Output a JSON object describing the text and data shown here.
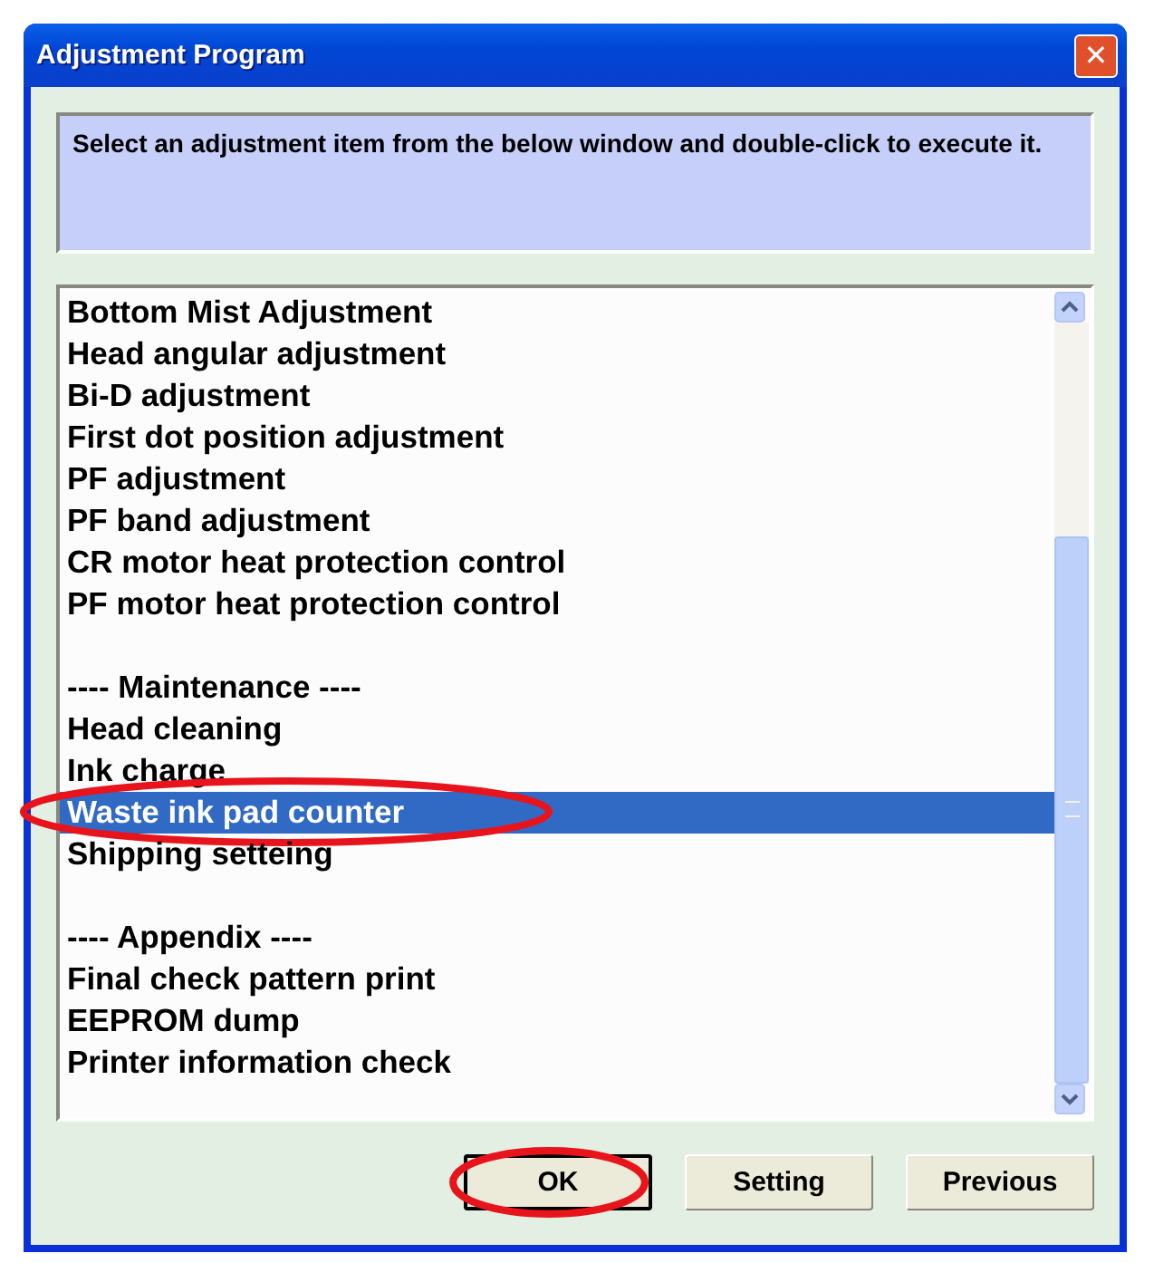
{
  "window": {
    "title": "Adjustment Program",
    "close": "✕"
  },
  "message": "Select an adjustment item from the below window and double-click to execute it.",
  "list": [
    {
      "kind": "item",
      "label": "Bottom Mist Adjustment",
      "selected": false,
      "circled": false
    },
    {
      "kind": "item",
      "label": "Head angular adjustment",
      "selected": false,
      "circled": false
    },
    {
      "kind": "item",
      "label": "Bi-D adjustment",
      "selected": false,
      "circled": false
    },
    {
      "kind": "item",
      "label": "First dot position adjustment",
      "selected": false,
      "circled": false
    },
    {
      "kind": "item",
      "label": "PF adjustment",
      "selected": false,
      "circled": false
    },
    {
      "kind": "item",
      "label": "PF band adjustment",
      "selected": false,
      "circled": false
    },
    {
      "kind": "item",
      "label": "CR motor heat protection control",
      "selected": false,
      "circled": false
    },
    {
      "kind": "item",
      "label": "PF motor heat protection control",
      "selected": false,
      "circled": false
    },
    {
      "kind": "spacer"
    },
    {
      "kind": "item",
      "label": "---- Maintenance ----",
      "selected": false,
      "circled": false
    },
    {
      "kind": "item",
      "label": "Head cleaning",
      "selected": false,
      "circled": false
    },
    {
      "kind": "item",
      "label": "Ink charge",
      "selected": false,
      "circled": false
    },
    {
      "kind": "item",
      "label": "Waste ink pad counter",
      "selected": true,
      "circled": true
    },
    {
      "kind": "item",
      "label": "Shipping setteing",
      "selected": false,
      "circled": false
    },
    {
      "kind": "spacer"
    },
    {
      "kind": "item",
      "label": "---- Appendix ----",
      "selected": false,
      "circled": false
    },
    {
      "kind": "item",
      "label": "Final check pattern print",
      "selected": false,
      "circled": false
    },
    {
      "kind": "item",
      "label": "EEPROM dump",
      "selected": false,
      "circled": false
    },
    {
      "kind": "item",
      "label": "Printer information check",
      "selected": false,
      "circled": false
    }
  ],
  "buttons": [
    {
      "label": "OK",
      "default": true,
      "circled": true
    },
    {
      "label": "Setting",
      "default": false,
      "circled": false
    },
    {
      "label": "Previous",
      "default": false,
      "circled": false
    }
  ]
}
